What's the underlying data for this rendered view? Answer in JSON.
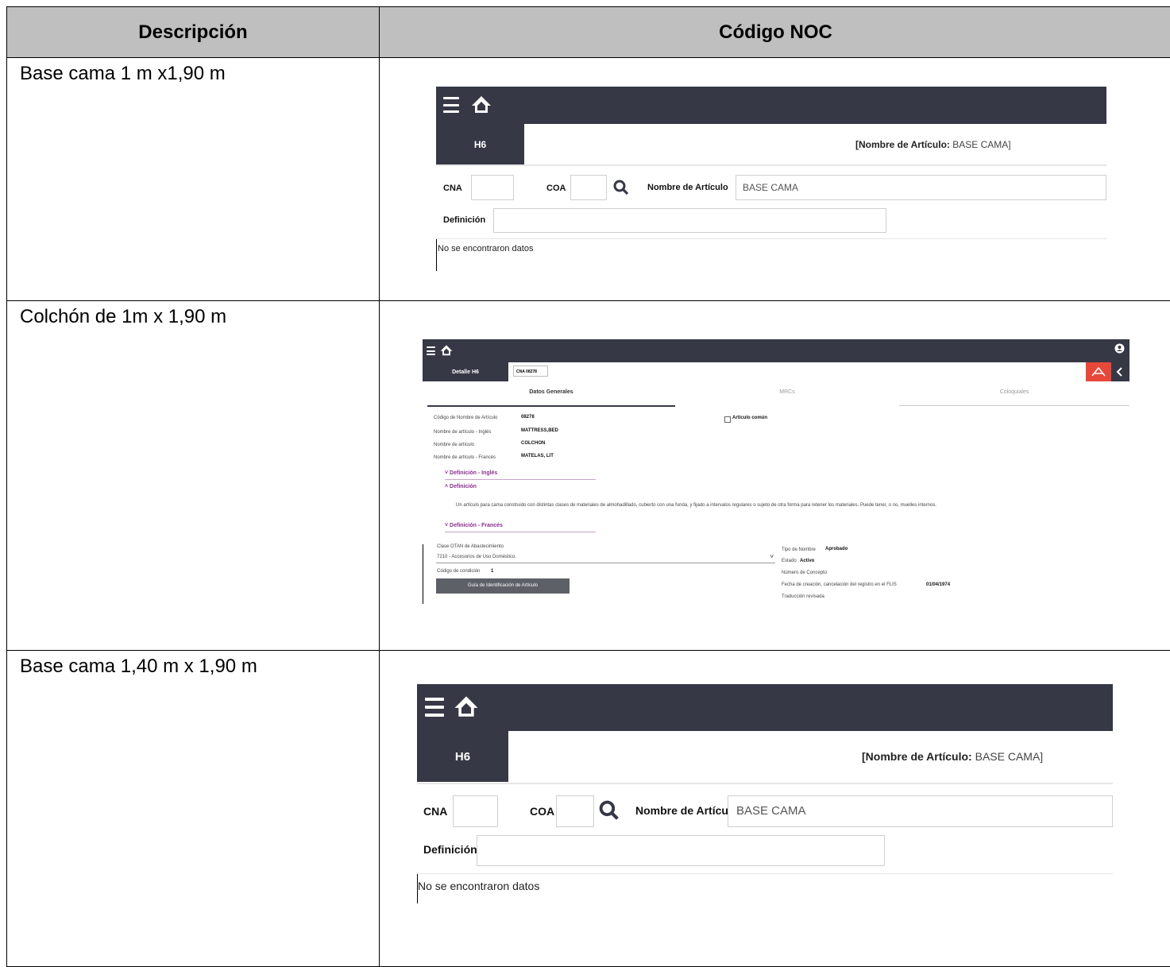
{
  "header": {
    "col_desc": "Descripción",
    "col_code": "Código NOC"
  },
  "rows": [
    {
      "description": "Base cama 1 m x1,90 m"
    },
    {
      "description": "Colchón de 1m  x 1,90 m"
    },
    {
      "description": "Base cama 1,40 m x 1,90 m"
    }
  ],
  "search_app": {
    "tab": "H6",
    "title_label": "[Nombre de Artículo:",
    "title_value": "BASE CAMA]",
    "cna_label": "CNA",
    "coa_label": "COA",
    "nombre_label": "Nombre de Artículo",
    "nombre_value": "BASE CAMA",
    "definicion_label": "Definición",
    "no_data": "No se encontraron datos"
  },
  "detail_app": {
    "tab": "Detalle H6",
    "cna_chip": "CNA 08278",
    "tabs": [
      "Datos Generales",
      "MRCs",
      "Coloquiales"
    ],
    "fields": [
      {
        "label": "Código de Nombre de Artículo",
        "value": "08278"
      },
      {
        "label": "Nombre de artículo - Inglés",
        "value": "MATTRESS,BED"
      },
      {
        "label": "Nombre de artículo",
        "value": "COLCHON"
      },
      {
        "label": "Nombre de artículo - Francés",
        "value": "MATELAS, LIT"
      }
    ],
    "checkbox_label": "Artículo común",
    "sec_def_ingles": "Definición - Inglés",
    "sec_def": "Definición",
    "definition_text": "Un artículo para cama construido con distintas clases de materiales de almohadillado, cubierto con una funda, y fijado a intervalos regulares o sujeto de otra forma para retener los materiales. Puede tener, o no, muelles internos.",
    "sec_def_frances": "Definición - Francés",
    "clase_label": "Clase OTAN de Abastecimiento",
    "clase_value": "7210 - Accesorios de Uso Doméstico.",
    "cond_label": "Código de condición",
    "cond_value": "1",
    "guide_button": "Guía de Identificación de Artículo",
    "tipo_label": "Tipo de Nombre",
    "tipo_value": "Aprobado",
    "estado_label": "Estado",
    "estado_value": "Activo",
    "concepto_label": "Número de Concepto",
    "fecha_label": "Fecha de creación, cancelación del registro en el FLIS",
    "fecha_value": "01/04/1974",
    "traduccion_label": "Traducción revisada",
    "colors": {
      "bar": "#363846",
      "pdf": "#e8473a",
      "accent": "#8a2f8f"
    }
  }
}
